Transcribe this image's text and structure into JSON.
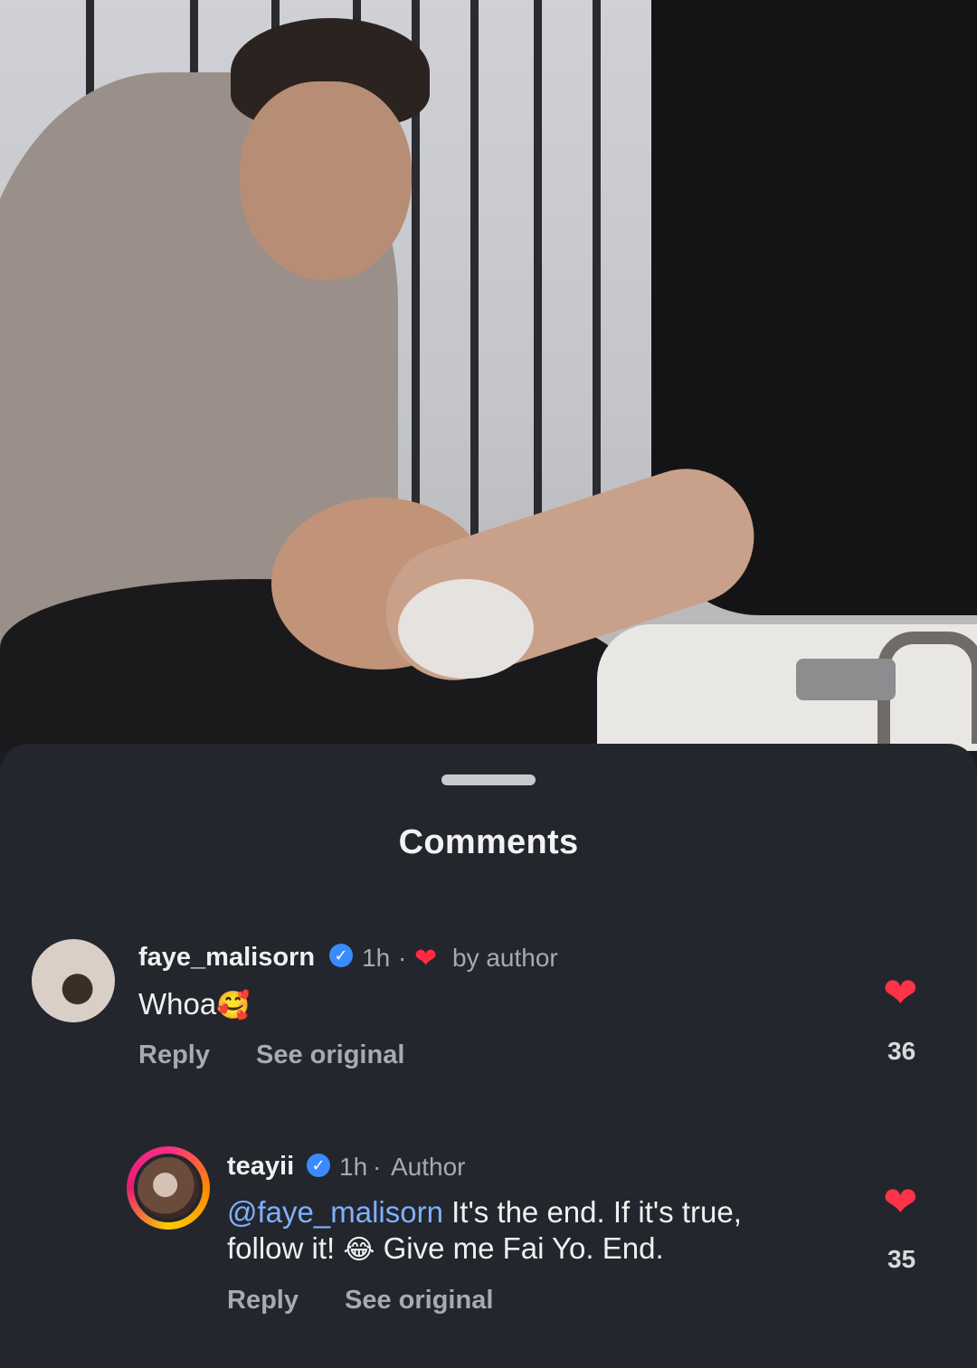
{
  "sheet": {
    "title": "Comments"
  },
  "comments": [
    {
      "username": "faye_malisorn",
      "time": "1h",
      "separator": "·",
      "liked_label": "by author",
      "text": "Whoa",
      "emoji": "🥰",
      "reply_label": "Reply",
      "see_original_label": "See original",
      "likes": "36"
    },
    {
      "username": "teayii",
      "time": "1h",
      "separator": "·",
      "role": "Author",
      "mention": "@faye_malisorn",
      "text_part1": " It's the end. If it's true,",
      "text_part2": "follow it! ",
      "emoji": "😂",
      "text_part3": " Give me Fai Yo. End.",
      "reply_label": "Reply",
      "see_original_label": "See original",
      "likes": "35"
    }
  ],
  "icons": {
    "verified": "verified-badge-icon",
    "heart": "heart-icon",
    "like": "like-heart-icon"
  },
  "colors": {
    "sheet_bg": "#23262d",
    "accent_mention": "#7fb0ff",
    "heart": "#ff3347",
    "verified": "#3a8bff"
  }
}
